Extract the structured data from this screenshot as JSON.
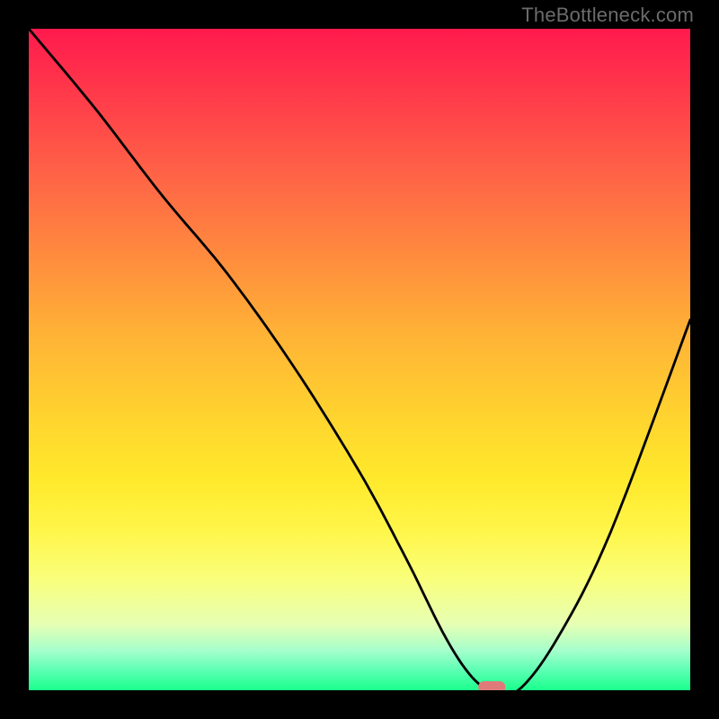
{
  "watermark": "TheBottleneck.com",
  "chart_data": {
    "type": "line",
    "title": "",
    "xlabel": "",
    "ylabel": "",
    "xlim": [
      0,
      100
    ],
    "ylim": [
      0,
      100
    ],
    "grid": false,
    "legend": false,
    "background_gradient": {
      "direction": "vertical",
      "stops": [
        {
          "pos": 0.0,
          "color": "#ff1a4d"
        },
        {
          "pos": 0.5,
          "color": "#ffc531"
        },
        {
          "pos": 0.8,
          "color": "#fff64a"
        },
        {
          "pos": 1.0,
          "color": "#1aff8c"
        }
      ]
    },
    "series": [
      {
        "name": "bottleneck-curve",
        "x": [
          0,
          10,
          20,
          30,
          40,
          50,
          57,
          63,
          67,
          70,
          74,
          80,
          88,
          100
        ],
        "y": [
          100,
          88,
          75,
          63,
          49,
          33,
          20,
          8,
          2,
          0,
          0,
          8,
          24,
          56
        ]
      }
    ],
    "marker": {
      "name": "optimal-point",
      "x": 70,
      "y": 0,
      "color": "#e07a7a",
      "shape": "rounded-rect"
    }
  }
}
